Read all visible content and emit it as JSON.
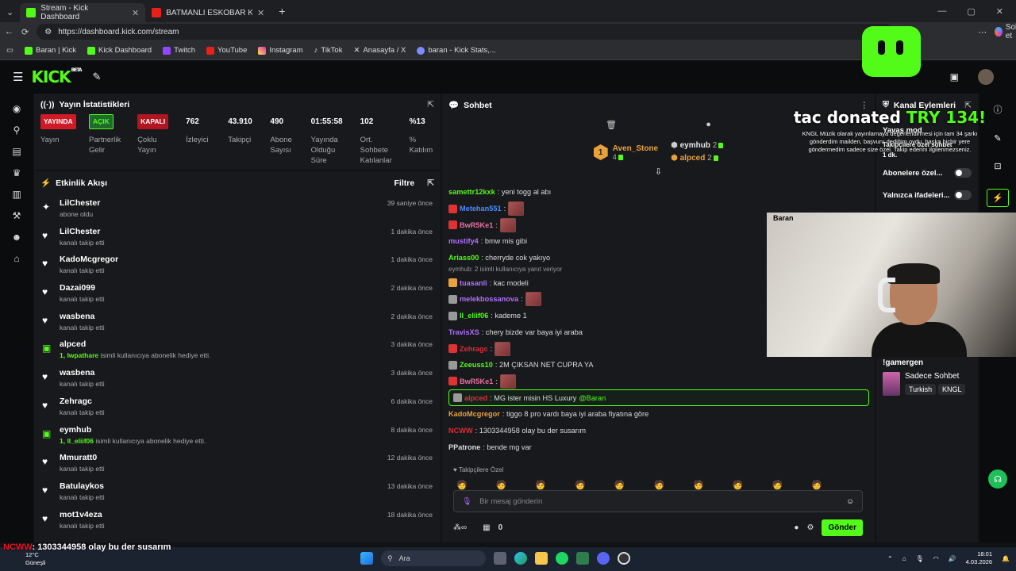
{
  "browser": {
    "tabs": [
      {
        "title": "Stream - Kick Dashboard",
        "active": true
      },
      {
        "title": "BATMANLI ESKOBAR KOLOMBİYA",
        "active": false
      }
    ],
    "url": "https://dashboard.kick.com/stream",
    "sohbet_et": "Sohbet et",
    "bookmarks": [
      "Baran | Kick",
      "Kick Dashboard",
      "Twitch",
      "YouTube",
      "Instagram",
      "TikTok",
      "Anasayfa / X",
      "baran - Kick Stats,..."
    ]
  },
  "header": {
    "logo": "KICK",
    "beta": "BETA"
  },
  "stats": {
    "title": "Yayın İstatistikleri",
    "items": [
      {
        "value": "YAYINDA",
        "label": "Yayın",
        "kind": "badge-red"
      },
      {
        "value": "AÇIK",
        "label": "Partnerlik Gelir Programı",
        "kind": "badge-green"
      },
      {
        "value": "KAPALI",
        "label": "Çoklu Yayın",
        "kind": "badge-red"
      },
      {
        "value": "762",
        "label": "İzleyici"
      },
      {
        "value": "43.910",
        "label": "Takipçi"
      },
      {
        "value": "490",
        "label": "Abone Sayısı"
      },
      {
        "value": "01:55:58",
        "label": "Yayında Olduğu Süre"
      },
      {
        "value": "102",
        "label": "Ort. Sohbete Katılanlar"
      },
      {
        "value": "%13",
        "label": "% Katılım"
      }
    ]
  },
  "activity": {
    "title": "Etkinlik Akışı",
    "filter": "Filtre",
    "items": [
      {
        "name": "LilChester",
        "sub": "abone oldu",
        "time": "39 saniye önce",
        "icon": "sparkle"
      },
      {
        "name": "LilChester",
        "sub": "kanalı takip etti",
        "time": "1 dakika önce",
        "icon": "heart"
      },
      {
        "name": "KadoMcgregor",
        "sub": "kanalı takip etti",
        "time": "1 dakika önce",
        "icon": "heart"
      },
      {
        "name": "Dazai099",
        "sub": "kanalı takip etti",
        "time": "2 dakika önce",
        "icon": "heart"
      },
      {
        "name": "wasbena",
        "sub": "kanalı takip etti",
        "time": "2 dakika önce",
        "icon": "heart"
      },
      {
        "name": "alpced",
        "sub_hl": "1, lwpathare",
        "sub": " isimli kullanıcıya abonelik hediye etti.",
        "time": "3 dakika önce",
        "icon": "gift"
      },
      {
        "name": "wasbena",
        "sub": "kanalı takip etti",
        "time": "3 dakika önce",
        "icon": "heart"
      },
      {
        "name": "Zehragc",
        "sub": "kanalı takip etti",
        "time": "6 dakika önce",
        "icon": "heart"
      },
      {
        "name": "eymhub",
        "sub_hl": "1, ll_eliif06",
        "sub": " isimli kullanıcıya abonelik hediye etti.",
        "time": "8 dakika önce",
        "icon": "gift"
      },
      {
        "name": "Mmuratt0",
        "sub": "kanalı takip etti",
        "time": "12 dakika önce",
        "icon": "heart"
      },
      {
        "name": "Batulaykos",
        "sub": "kanalı takip etti",
        "time": "13 dakika önce",
        "icon": "heart"
      },
      {
        "name": "mot1v4eza",
        "sub": "kanalı takip etti",
        "time": "18 dakika önce",
        "icon": "heart"
      }
    ]
  },
  "chat": {
    "title": "Sohbet",
    "leaders": [
      {
        "rank": "1",
        "name": "Aven_Stone",
        "count": "4"
      },
      {
        "name": "eymhub",
        "count": "2"
      },
      {
        "name": "alpced",
        "count": "2"
      }
    ],
    "messages": [
      {
        "user": "samettr12kxk",
        "color": "#53fc18",
        "text": ": yeni togg al abı"
      },
      {
        "user": "Metehan551",
        "color": "#4d8cff",
        "text": ":",
        "emote": true
      },
      {
        "user": "BwR5Ke1",
        "color": "#e86fa3",
        "text": ":",
        "emote": true
      },
      {
        "user": "mustify4",
        "color": "#b06fff",
        "text": ": bmw mis gibi"
      },
      {
        "user": "Ariass00",
        "color": "#53fc18",
        "text": ": cherryde cok yakıyo"
      },
      {
        "user": "tuasanli",
        "color": "#b06fff",
        "text": ": kac modeli",
        "reply": "eymhub: 2 isimli kullanıcıya yanıt veriyor"
      },
      {
        "user": "melekbossanova",
        "color": "#b06fff",
        "text": ":",
        "emote": true
      },
      {
        "user": "ll_eliif06",
        "color": "#53fc18",
        "text": ": kademe 1"
      },
      {
        "user": "TravisXS",
        "color": "#b06fff",
        "text": ": chery bizde var baya iyi araba"
      },
      {
        "user": "Zehragc",
        "color": "#e12b3a",
        "text": ":",
        "emote": true
      },
      {
        "user": "Zeeuss10",
        "color": "#53fc18",
        "text": ": 2M ÇIKSAN NET CUPRA YA"
      },
      {
        "user": "BwR5Ke1",
        "color": "#e86fa3",
        "text": ":",
        "emote": true
      },
      {
        "user": "alpced",
        "color": "#e12b3a",
        "text": ": MG ister misin HS Luxury ",
        "mention": "@Baran",
        "highlight": true
      },
      {
        "user": "KadoMcgregor",
        "color": "#e9a13b",
        "text": ": tiggo 8 pro vardı baya iyi araba fiyatına göre"
      },
      {
        "user": "NCWW",
        "color": "#e12b3a",
        "text": ": 1303344958 olay bu der susarım"
      },
      {
        "user": "PPatrone",
        "color": "#dddddd",
        "text": ": bende mg var"
      }
    ],
    "followers_only": "Takipçilere Özel",
    "placeholder": "Bir mesaj gönderin",
    "points": "0",
    "send": "Gönder"
  },
  "channel_actions": {
    "title": "Kanal Eylemleri",
    "slow_mode": "Yavaş mod",
    "followers_mode": "Takipçilere özel sohbet",
    "followers_dur": "1 dk.",
    "subs_only": "Abonelere özel...",
    "emotes_only": "Yalnızca ifadeleri..."
  },
  "donation": {
    "name": "tac",
    "verb": "donated",
    "amount": "TRY 134!",
    "message": "KNGL Müzik olarak yayınlamaya değerlendirmesi için tam 34 şarkı gönderdim mailden, başvuru dediğim oydu. başka hiçbir yere göndermedim sadece size özel. Takip ederim ilgilenmezseniz."
  },
  "webcam": {
    "label": "Baran"
  },
  "side_info": {
    "category": "!gamergen",
    "mode": "Sadece Sohbet",
    "tags": [
      "Turkish",
      "KNGL"
    ]
  },
  "ticker": {
    "user": "NCWW",
    "text": ": 1303344958 olay bu der susarım"
  },
  "taskbar": {
    "temp": "12°C",
    "weather": "Güneşli",
    "search": "Ara",
    "time": "18:01",
    "date": "4.03.2026"
  },
  "colors": {
    "accent": "#53fc18",
    "live": "#d01b27"
  }
}
